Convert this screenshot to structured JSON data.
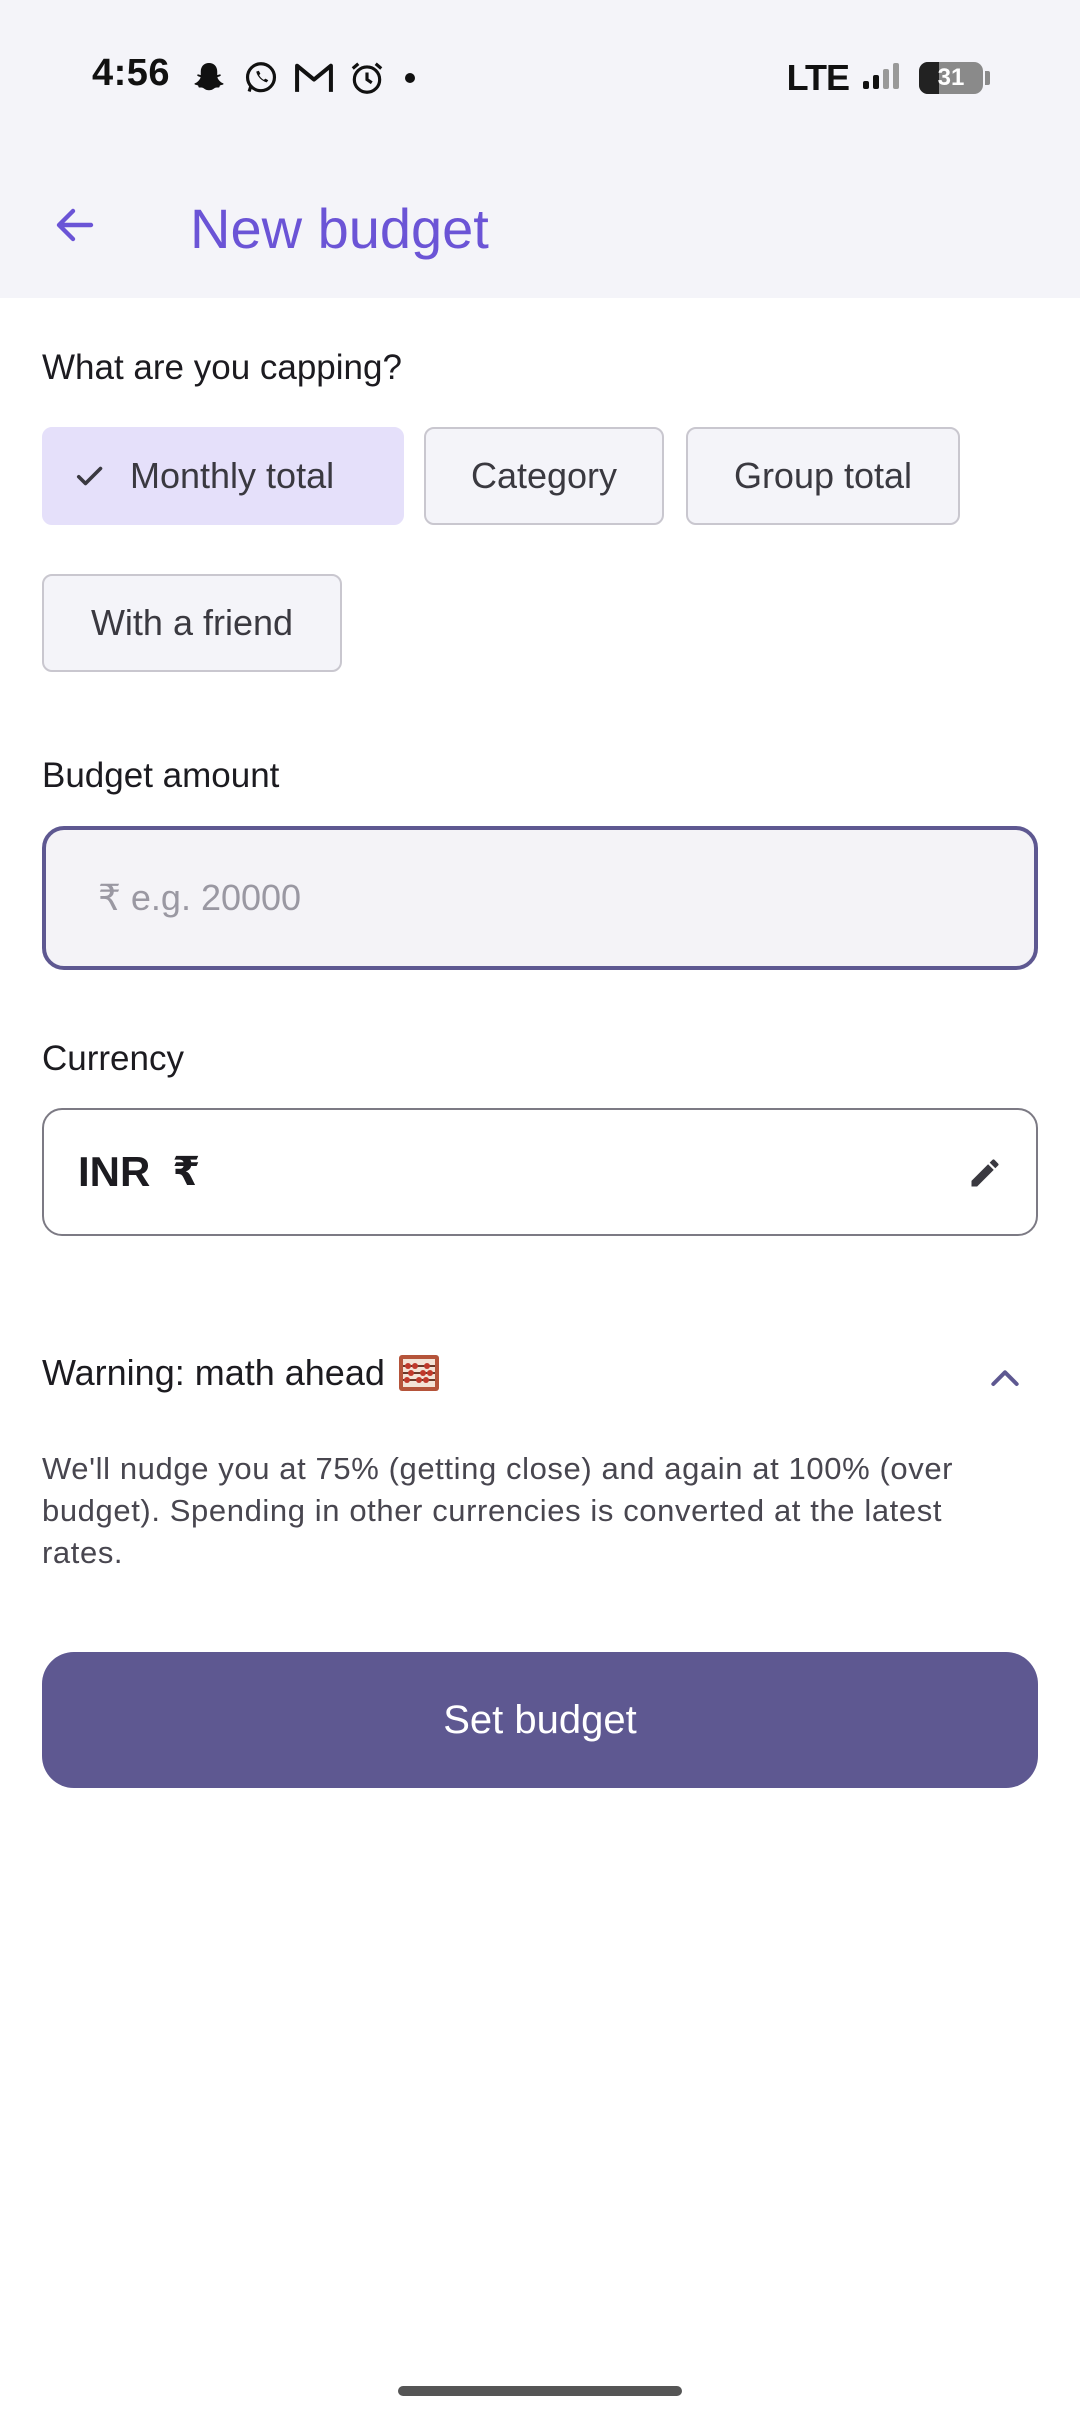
{
  "status_bar": {
    "time": "4:56",
    "network": "LTE",
    "battery": "31",
    "notification_icons": [
      "snapchat-icon",
      "whatsapp-icon",
      "gmail-icon",
      "alarm-icon",
      "dot-icon"
    ]
  },
  "app_bar": {
    "title": "New budget",
    "back_icon": "arrow-left-icon"
  },
  "capping": {
    "label": "What are you capping?",
    "options": [
      {
        "label": "Monthly total",
        "selected": true
      },
      {
        "label": "Category",
        "selected": false
      },
      {
        "label": "Group total",
        "selected": false
      },
      {
        "label": "With a friend",
        "selected": false
      }
    ]
  },
  "amount": {
    "label": "Budget amount",
    "value": "",
    "placeholder": "₹ e.g. 20000"
  },
  "currency": {
    "label": "Currency",
    "code": "INR",
    "symbol": "₹",
    "edit_icon": "pencil-icon"
  },
  "warning": {
    "title": "Warning: math ahead",
    "icon": "abacus-icon",
    "body": "We'll nudge you at 75% (getting close) and again at 100% (over budget). Spending in other currencies is converted at the latest rates.",
    "expanded": true
  },
  "actions": {
    "submit_label": "Set budget"
  },
  "colors": {
    "accent": "#6b54d6",
    "primary_button": "#5e5891",
    "selected_chip": "#e5e0fa",
    "header_bg": "#f4f4f9"
  }
}
